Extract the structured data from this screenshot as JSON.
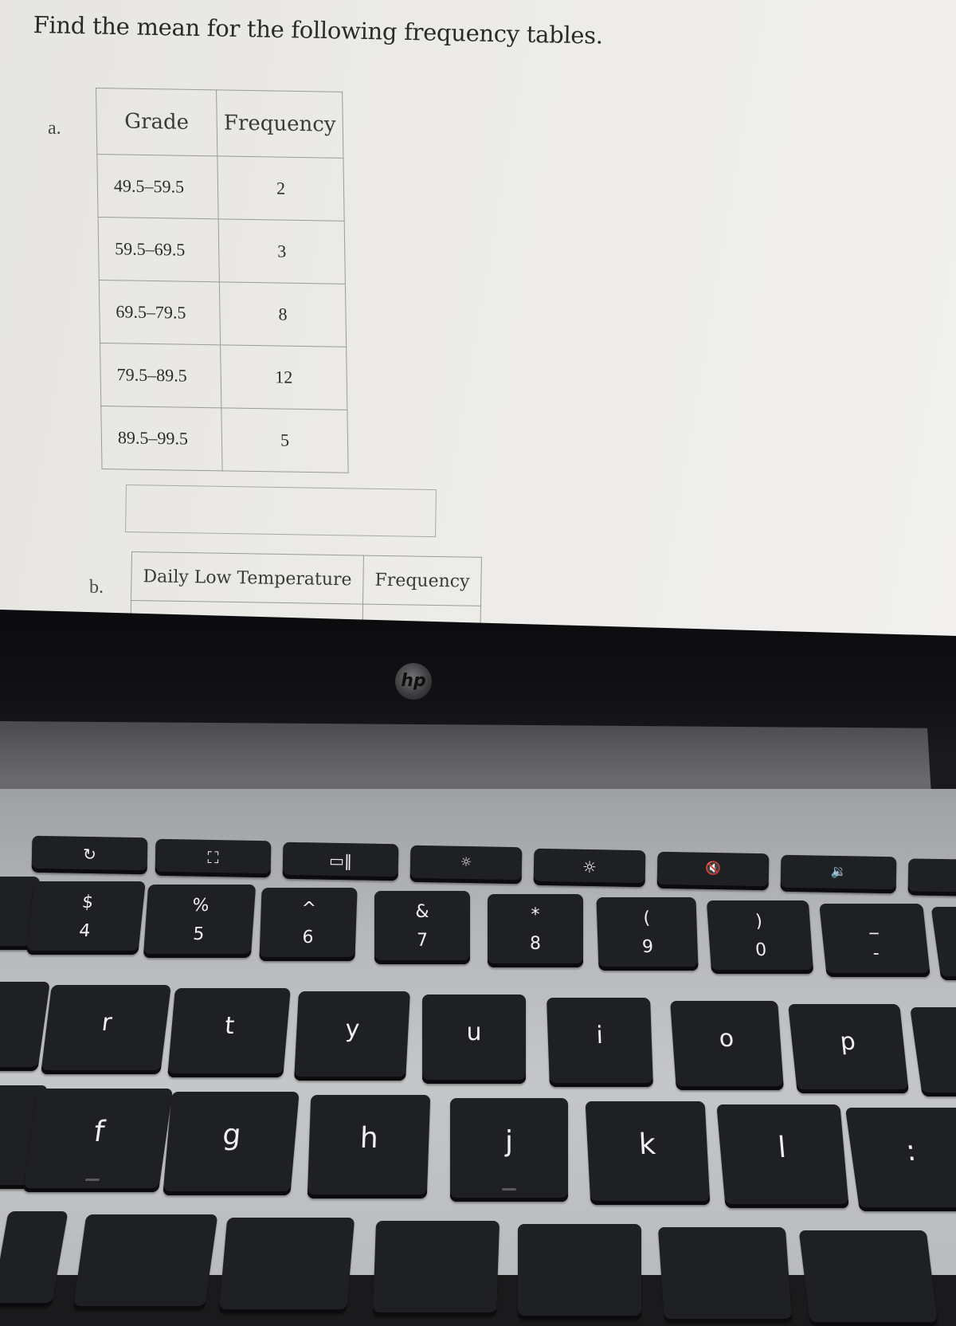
{
  "worksheet": {
    "instructions": "Find the mean for the following frequency tables.",
    "part_a": {
      "label": "a.",
      "headers": [
        "Grade",
        "Frequency"
      ],
      "rows": [
        {
          "range": "49.5–59.5",
          "frequency": "2"
        },
        {
          "range": "59.5–69.5",
          "frequency": "3"
        },
        {
          "range": "69.5–79.5",
          "frequency": "8"
        },
        {
          "range": "79.5–89.5",
          "frequency": "12"
        },
        {
          "range": "89.5–99.5",
          "frequency": "5"
        }
      ],
      "answer_value": ""
    },
    "part_b": {
      "label": "b.",
      "headers": [
        "Daily Low Temperature",
        "Frequency"
      ]
    }
  },
  "laptop": {
    "brand_logo": "hp",
    "function_row": [
      {
        "icon": "refresh-icon",
        "glyph": "↻"
      },
      {
        "icon": "fullscreen-icon",
        "glyph": "⛶"
      },
      {
        "icon": "overview-icon",
        "glyph": "▭‖"
      },
      {
        "icon": "brightness-down-icon",
        "glyph": "☼"
      },
      {
        "icon": "brightness-up-icon",
        "glyph": "☼"
      },
      {
        "icon": "mute-icon",
        "glyph": "🔇"
      },
      {
        "icon": "volume-down-icon",
        "glyph": "🔉"
      }
    ],
    "number_row": [
      {
        "top": "$",
        "bottom": "4"
      },
      {
        "top": "%",
        "bottom": "5"
      },
      {
        "top": "^",
        "bottom": "6"
      },
      {
        "top": "&",
        "bottom": "7"
      },
      {
        "top": "*",
        "bottom": "8"
      },
      {
        "top": "(",
        "bottom": "9"
      },
      {
        "top": ")",
        "bottom": "0"
      },
      {
        "top": "_",
        "bottom": "-"
      }
    ],
    "top_alpha_row": [
      "r",
      "t",
      "y",
      "u",
      "i",
      "o",
      "p"
    ],
    "home_row": [
      "f",
      "g",
      "h",
      "j",
      "k",
      "l",
      ":"
    ]
  }
}
